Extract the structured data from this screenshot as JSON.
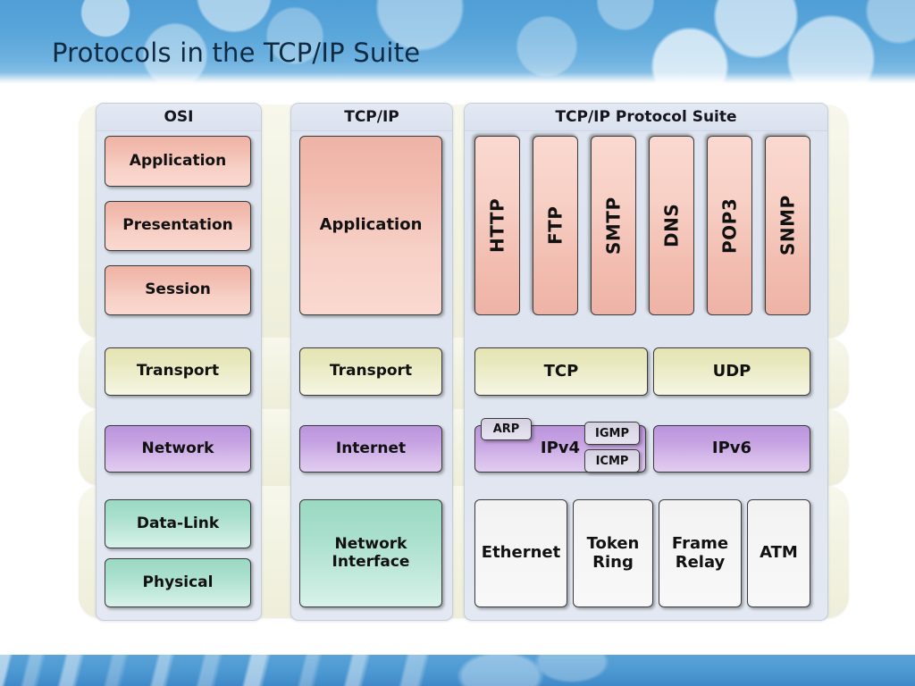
{
  "page_title": "Protocols in the TCP/IP Suite",
  "columns": [
    {
      "id": "osi",
      "header": "OSI"
    },
    {
      "id": "tcpip",
      "header": "TCP/IP"
    },
    {
      "id": "suite",
      "header": "TCP/IP Protocol Suite"
    }
  ],
  "osi_layers": {
    "application": "Application",
    "presentation": "Presentation",
    "session": "Session",
    "transport": "Transport",
    "network": "Network",
    "datalink": "Data-Link",
    "physical": "Physical"
  },
  "tcpip_layers": {
    "application": "Application",
    "transport": "Transport",
    "internet": "Internet",
    "network_interface": "Network\nInterface",
    "network_interface_line1": "Network",
    "network_interface_line2": "Interface"
  },
  "suite": {
    "application_protocols": [
      "HTTP",
      "FTP",
      "SMTP",
      "DNS",
      "POP3",
      "SNMP"
    ],
    "transport_protocols": [
      "TCP",
      "UDP"
    ],
    "internet_protocols": [
      "IPv4",
      "IPv6"
    ],
    "internet_sub_protocols": [
      "ARP",
      "IGMP",
      "ICMP"
    ],
    "link_protocols": [
      "Ethernet",
      "Token\nRing",
      "Frame\nRelay",
      "ATM"
    ],
    "link_protocol_lines": [
      [
        "Ethernet"
      ],
      [
        "Token",
        "Ring"
      ],
      [
        "Frame",
        "Relay"
      ],
      [
        "ATM"
      ]
    ]
  },
  "colors": {
    "header_blue": "#59a6da",
    "footer_blue": "#4b97d1",
    "title_text": "#102a43",
    "band_cream": "#f2f2e0",
    "column_panel": "#dde4ef",
    "application_pink": "#f2bdb0",
    "transport_khaki": "#e9e9c0",
    "network_purple": "#c6a2e2",
    "link_mint": "#a9dfcd",
    "protocol_white": "#f5f5f5",
    "sub_lilac": "#dcd9e8"
  }
}
